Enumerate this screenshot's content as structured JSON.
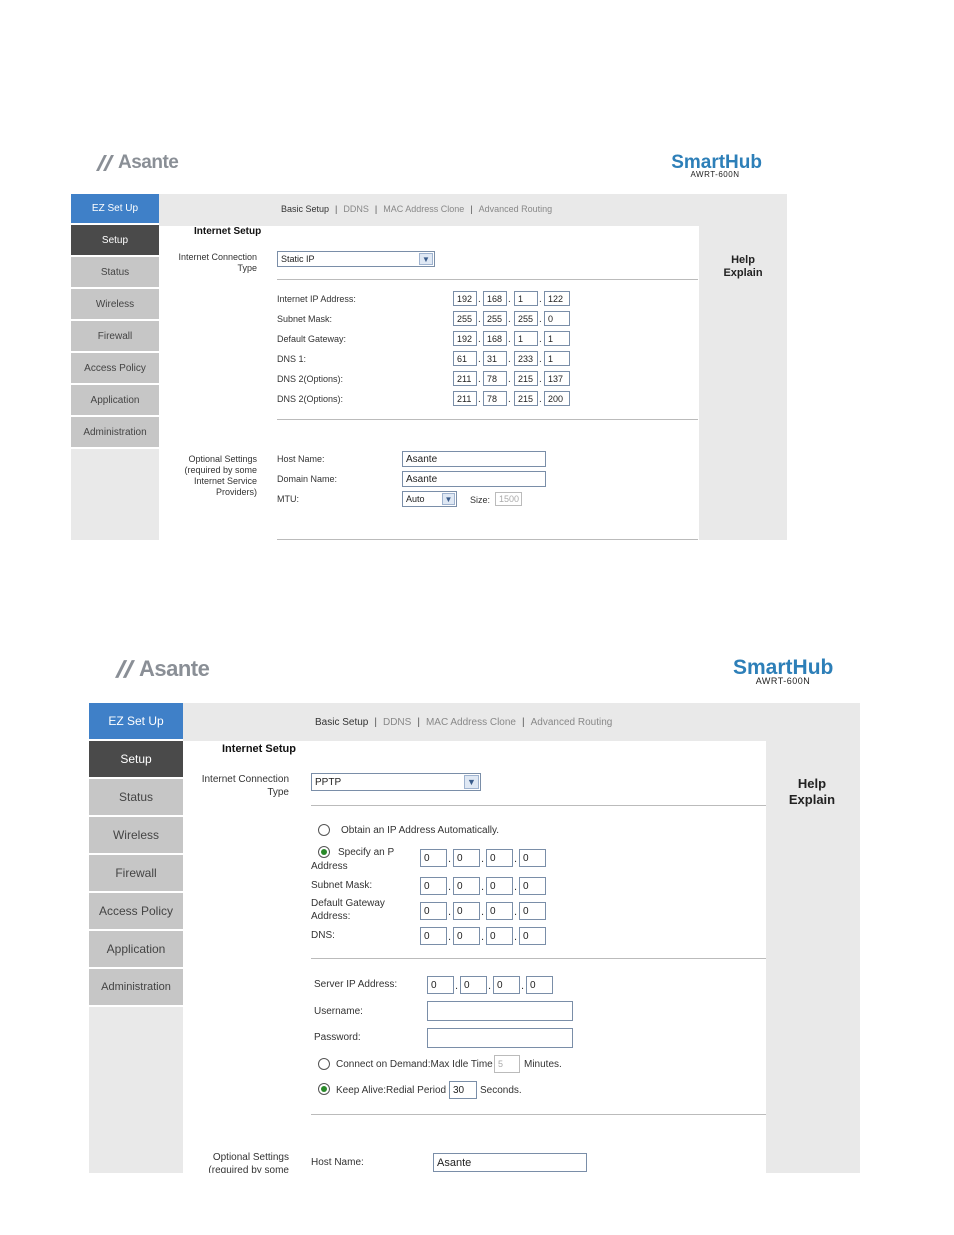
{
  "panel1": {
    "logo_text": "Asante",
    "brand": "SmartHub",
    "model": "AWRT-600N",
    "side_items": [
      "EZ Set Up",
      "Setup",
      "Status",
      "Wireless",
      "Firewall",
      "Access Policy",
      "Application",
      "Administration"
    ],
    "tabs": [
      "Basic Setup",
      "DDNS",
      "MAC Address Clone",
      "Advanced Routing"
    ],
    "tab_sep": "|",
    "help": "Help",
    "explain": "Explain",
    "section_title": "Internet Setup",
    "conn_label_1": "Internet Connection",
    "conn_label_2": "Type",
    "conn_value": "Static IP",
    "ip_rows": [
      {
        "label": "Internet IP Address:",
        "octets": [
          "192",
          "168",
          "1",
          "122"
        ]
      },
      {
        "label": "Subnet Mask:",
        "octets": [
          "255",
          "255",
          "255",
          "0"
        ]
      },
      {
        "label": "Default Gateway:",
        "octets": [
          "192",
          "168",
          "1",
          "1"
        ]
      },
      {
        "label": "DNS 1:",
        "octets": [
          "61",
          "31",
          "233",
          "1"
        ]
      },
      {
        "label": "DNS 2(Options):",
        "octets": [
          "211",
          "78",
          "215",
          "137"
        ]
      },
      {
        "label": "DNS 2(Options):",
        "octets": [
          "211",
          "78",
          "215",
          "200"
        ]
      }
    ],
    "opt_label": [
      "Optional Settings",
      "(required by some",
      "Internet Service",
      "Providers)"
    ],
    "host_label": "Host Name:",
    "host_value": "Asante",
    "domain_label": "Domain Name:",
    "domain_value": "Asante",
    "mtu_label": "MTU:",
    "mtu_value": "Auto",
    "size_label": "Size:",
    "size_value": "1500"
  },
  "panel2": {
    "logo_text": "Asante",
    "brand": "SmartHub",
    "model": "AWRT-600N",
    "side_items": [
      "EZ Set Up",
      "Setup",
      "Status",
      "Wireless",
      "Firewall",
      "Access Policy",
      "Application",
      "Administration"
    ],
    "tabs": [
      "Basic Setup",
      "DDNS",
      "MAC Address Clone",
      "Advanced Routing"
    ],
    "tab_sep": "|",
    "help": "Help",
    "explain": "Explain",
    "section_title": "Internet Setup",
    "conn_label_1": "Internet Connection",
    "conn_label_2": "Type",
    "conn_value": "PPTP",
    "obtain_auto": "Obtain an IP Address Automatically.",
    "specify_1": "Specify an P",
    "specify_2": "Address",
    "ip_octets": [
      "0",
      "0",
      "0",
      "0"
    ],
    "subnet_label": "Subnet Mask:",
    "subnet_octets": [
      "0",
      "0",
      "0",
      "0"
    ],
    "gateway_label_1": "Default Gateway",
    "gateway_label_2": "Address:",
    "gateway_octets": [
      "0",
      "0",
      "0",
      "0"
    ],
    "dns_label": "DNS:",
    "dns_octets": [
      "0",
      "0",
      "0",
      "0"
    ],
    "server_label": "Server IP Address:",
    "server_octets": [
      "0",
      "0",
      "0",
      "0"
    ],
    "username_label": "Username:",
    "username_value": "",
    "password_label": "Password:",
    "password_value": "",
    "connect_demand": "Connect on Demand:Max Idle Time",
    "idle_value": "5",
    "minutes": "Minutes.",
    "keep_alive": "Keep Alive:Redial Period",
    "redial_value": "30",
    "seconds": "Seconds.",
    "opt_label": [
      "Optional Settings",
      "(required by some"
    ],
    "host_label": "Host Name:",
    "host_value": "Asante"
  },
  "colors": {
    "ez_blue": "#3f80c8",
    "active_dark": "#4a4a4a",
    "brand_blue": "#2d7fb8",
    "sidebar_gray": "#c6c6c6"
  }
}
